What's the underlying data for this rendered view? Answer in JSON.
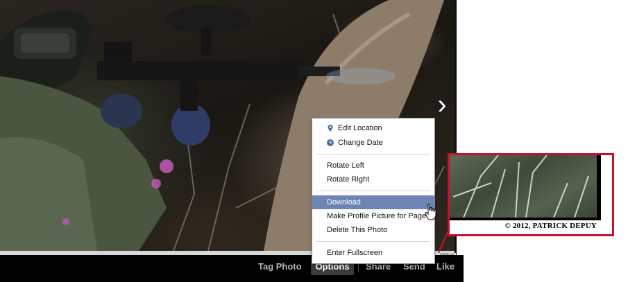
{
  "photo": {
    "next_icon": "chevron-right-icon",
    "credit_mini": "DEPUY"
  },
  "actionbar": {
    "tag_photo": "Tag Photo",
    "options": "Options",
    "share": "Share",
    "send": "Send",
    "like": "Like"
  },
  "menu": {
    "items": [
      {
        "label": "Edit Location",
        "icon": "location-pin-icon"
      },
      {
        "label": "Change Date",
        "icon": "clock-icon"
      },
      {
        "label": "Rotate Left"
      },
      {
        "label": "Rotate Right"
      },
      {
        "label": "Download",
        "highlighted": true
      },
      {
        "label": "Make Profile Picture for Page"
      },
      {
        "label": "Delete This Photo"
      },
      {
        "label": "Enter Fullscreen"
      }
    ],
    "highlight_color": "#6d84b4"
  },
  "zoom_inset": {
    "credit": "© 2012, PATRICK DEPUY",
    "border_color": "#c8102e"
  }
}
